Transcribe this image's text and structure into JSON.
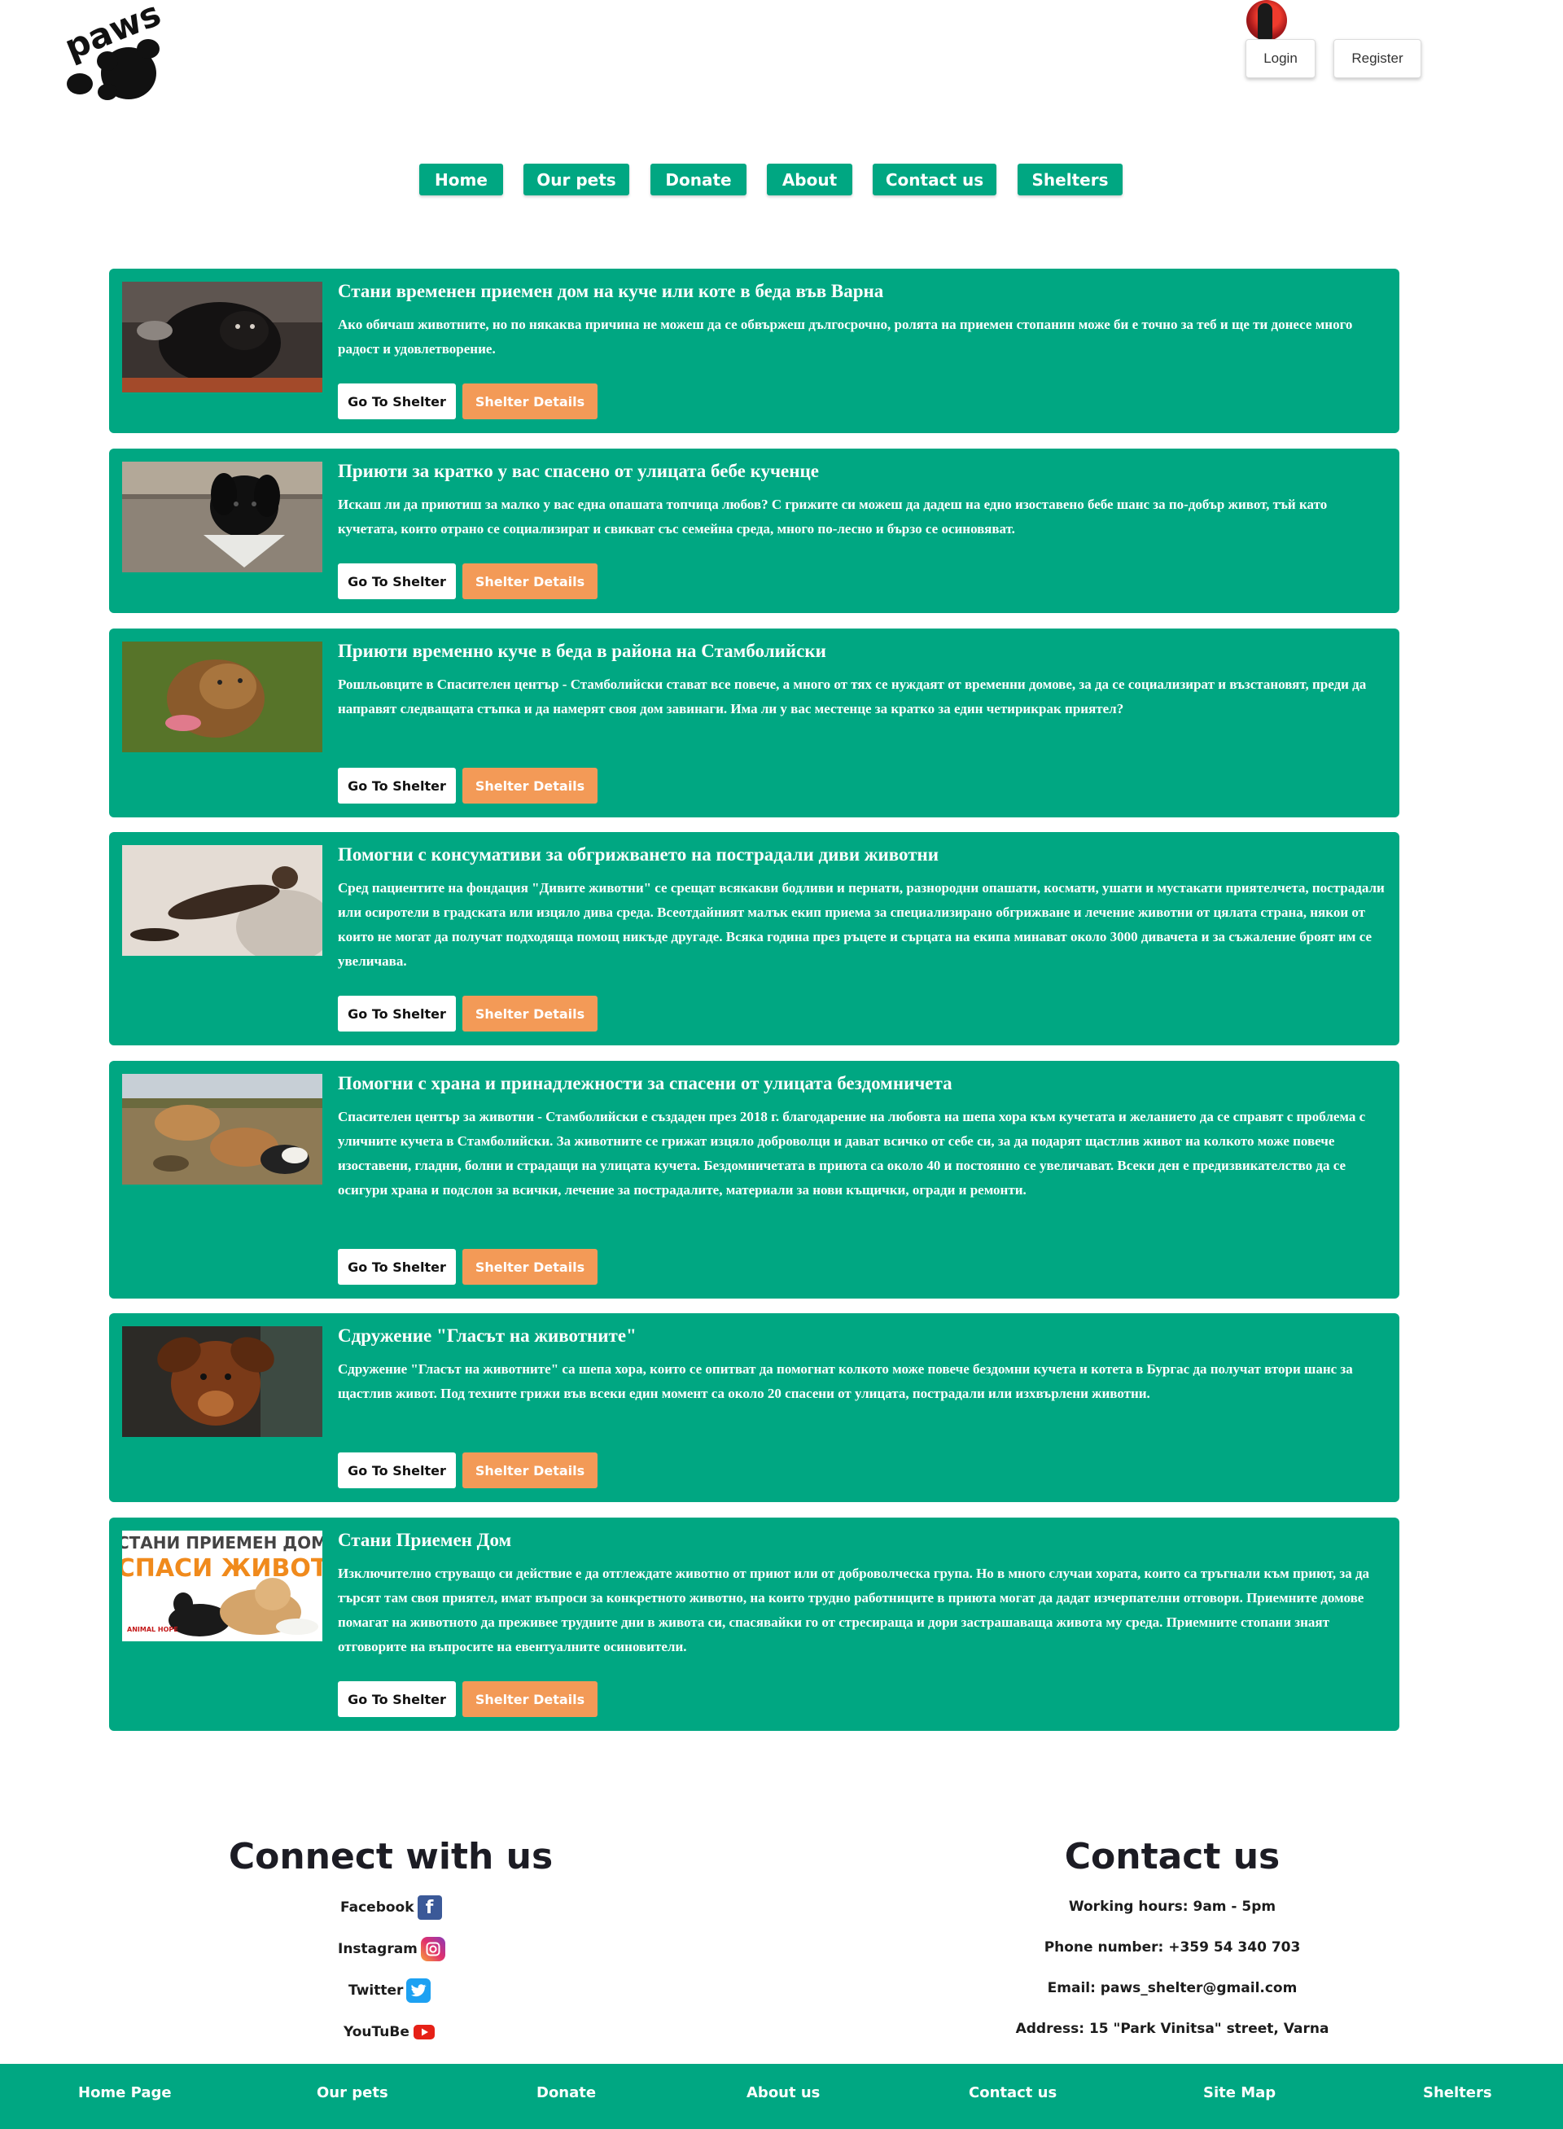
{
  "header": {
    "logo_text": "paws",
    "login_label": "Login",
    "register_label": "Register"
  },
  "nav": [
    "Home",
    "Our pets",
    "Donate",
    "About",
    "Contact us",
    "Shelters"
  ],
  "cards": [
    {
      "title": "Стани временен приемен дом на куче или коте в беда във Варна",
      "text": "Ако обичаш животните, но по някаква причина не можеш да се обвържеш дългосрочно, ролята на приемен стопанин може би е точно за теб и ще ти донесе много радост и удовлетворение."
    },
    {
      "title": "Приюти за кратко у вас спасено от улицата бебе кученце",
      "text": "Искаш ли да приютиш за малко у вас една опашата топчица любов? С грижите си можеш да дадеш на едно изоставено бебе шанс за по-добър живот, тъй като кучетата, които отрано се социализират и свикват със семейна среда, много по-лесно и бързо се осиновяват."
    },
    {
      "title": "Приюти временно куче в беда в района на Стамболийски",
      "text": "Рошльовците в Спасителен център - Стамболийски стават все повече, а много от тях се нуждаят от временни домове, за да се социализират и възстановят, преди да направят следващата стъпка и да намерят своя дом завинаги. Има ли у вас местенце за кратко за един четирикрак приятел?"
    },
    {
      "title": "Помогни с консумативи за обгрижването на пострадали диви животни",
      "text": "Сред пациентите на фондация \"Дивите животни\" се срещат всякакви бодливи и пернати, разнородни опашати, космати, ушати и мустакати приятелчета, пострадали или осиротели в градската или изцяло дива среда. Всеотдайният малък екип приема за специализирано обгрижване и лечение животни от цялата страна, някои от които не могат да получат подходяща помощ никъде другаде. Всяка година през ръцете и сърцата на екипа минават около 3000 дивачета и за съжаление броят им се увеличава."
    },
    {
      "title": "Помогни с храна и принадлежности за спасени от улицата бездомничета",
      "text": "Спасителен център за животни - Стамболийски е създаден през 2018 г. благодарение на любовта на шепа хора към кучетата и желанието да се справят с проблема с уличните кучета в Стамболийски. За животните се грижат изцяло доброволци и дават всичко от себе си, за да подарят щастлив живот на колкото може повече изоставени, гладни, болни и страдащи на улицата кучета. Бездомничетата в приюта са около 40 и постоянно се увеличават. Всеки ден е предизвикателство да се осигури храна и подслон за всички, лечение за пострадалите, материали за нови къщички, огради и ремонти."
    },
    {
      "title": "Сдружение \"Гласът на животните\"",
      "text": "Сдружение \"Гласът на животните\" са шепа хора, които се опитват да помогнат колкото може повече бездомни кучета и котета в Бургас да получат втори шанс за щастлив живот. Под техните грижи във всеки един момент са около 20 спасени от улицата, пострадали или изхвърлени животни."
    },
    {
      "title": "Стани Приемен Дом",
      "text": "Изключително струващо си действие е да отглеждате животно от приют или от доброволческа група. Но в много случаи хората, които са тръгнали към приют, за да търсят там своя приятел, имат въпроси за конкретното животно, на които трудно работниците в приюта могат да дадат изчерпателни отговори. Приемните домове помагат на животното да преживее трудните дни в живота си, спасявайки го от стресираща и дори застрашаваща живота му среда. Приемните стопани знаят отговорите на въпросите на евентуалните осиновители."
    }
  ],
  "buttons": {
    "go_to_shelter": "Go To Shelter",
    "shelter_details": "Shelter Details"
  },
  "poster": {
    "line1": "СТАНИ ПРИЕМЕН ДОМ",
    "line2": "СПАСИ ЖИВОТ",
    "badge": "ANIMAL HOPE"
  },
  "connect": {
    "title": "Connect with us",
    "links": [
      "Facebook",
      "Instagram",
      "Twitter",
      "YouTuBe"
    ]
  },
  "contact": {
    "title": "Contact us",
    "hours": "Working hours: 9am - 5pm",
    "phone": "Phone number: +359 54 340 703",
    "email": "Email: paws_shelter@gmail.com",
    "address": "Address: 15 \"Park Vinitsa\" street, Varna"
  },
  "footer_links": [
    "Home Page",
    "Our pets",
    "Donate",
    "About us",
    "Contact us",
    "Site Map",
    "Shelters"
  ],
  "colors": {
    "primary": "#00a782",
    "accent": "#f39a57",
    "text_dark": "#1c1c24"
  },
  "icons": [
    "facebook-icon",
    "instagram-icon",
    "twitter-icon",
    "youtube-icon"
  ]
}
